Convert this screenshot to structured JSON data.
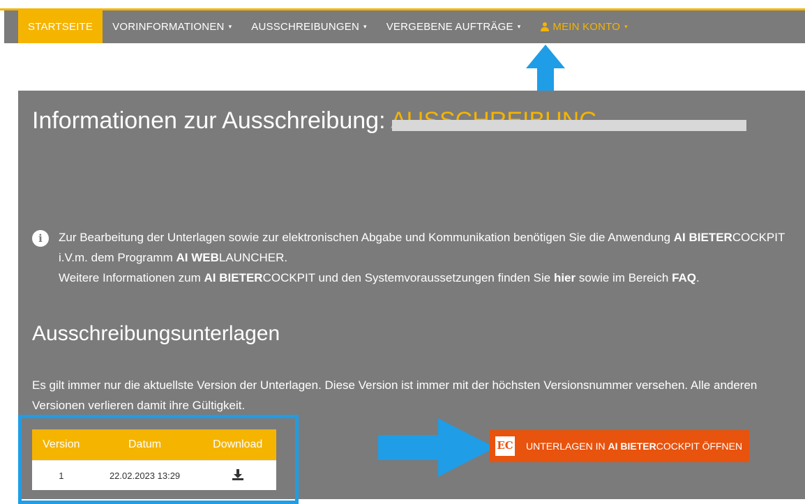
{
  "nav": {
    "items": [
      {
        "label": "STARTSEITE",
        "caret": ""
      },
      {
        "label": "VORINFORMATIONEN",
        "caret": "▾"
      },
      {
        "label": "AUSSCHREIBUNGEN",
        "caret": "▾"
      },
      {
        "label": "VERGEBENE AUFTRÄGE",
        "caret": "▾"
      },
      {
        "label": "MEIN KONTO",
        "caret": "▾"
      }
    ],
    "active_color": "#f5b400"
  },
  "page": {
    "title": "Informationen zur Ausschreibung:",
    "title_redacted": "AUSSCHREIBUNG"
  },
  "info": {
    "line1_a": "Zur Bearbeitung der Unterlagen sowie zur elektronischen Abgabe und Kommunikation benötigen Sie die Anwendung ",
    "line1_b1": "AI BIETER",
    "line1_c": "COCKPIT i.V.m. dem Programm ",
    "line1_b2": "AI WEB",
    "line1_d": "LAUNCHER.",
    "line2_a": "Weitere Informationen zum ",
    "line2_b1": "AI BIETER",
    "line2_c": "COCKPIT und den Systemvoraussetzungen finden Sie ",
    "line2_link": "hier",
    "line2_d": " sowie im Bereich ",
    "line2_faq": "FAQ",
    "line2_e": "."
  },
  "section": {
    "title": "Ausschreibungsunterlagen",
    "text": "Es gilt immer nur die aktuellste Version der Unterlagen. Diese Version ist immer mit der höchsten Versionsnummer versehen. Alle anderen Versionen verlieren damit ihre Gültigkeit."
  },
  "table": {
    "headers": {
      "version": "Version",
      "datum": "Datum",
      "download": "Download"
    },
    "rows": [
      {
        "version": "1",
        "datum": "22.02.2023 13:29",
        "download_icon": "download-icon"
      }
    ]
  },
  "open_button": {
    "logo": "EC",
    "label_a": "UNTERLAGEN IN ",
    "label_b": "AI BIETER",
    "label_c": "COCKPIT ÖFFNEN"
  },
  "colors": {
    "accent": "#f5b400",
    "panel": "#7b7b7b",
    "button": "#e8530e",
    "annotation": "#1f9de6"
  }
}
